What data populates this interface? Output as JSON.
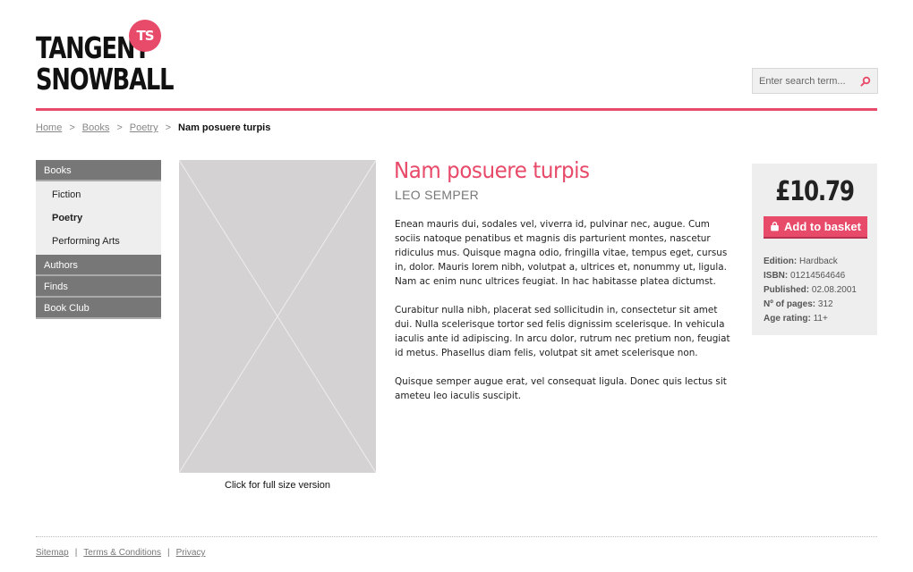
{
  "brand": {
    "line1": "TANGENT",
    "line2": "SNOWBALL",
    "badge": "TS",
    "accent_color": "#e84a69"
  },
  "search": {
    "placeholder": "Enter search term...",
    "icon": "search-icon"
  },
  "breadcrumb": {
    "items": [
      "Home",
      "Books",
      "Poetry"
    ],
    "separator": ">",
    "current": "Nam posuere turpis"
  },
  "sidebar": {
    "books": "Books",
    "sub_items": [
      "Fiction",
      "Poetry",
      "Performing Arts"
    ],
    "active_sub": "Poetry",
    "authors": "Authors",
    "finds": "Finds",
    "book_club": "Book Club"
  },
  "image": {
    "caption": "Click for full size version"
  },
  "book": {
    "title": "Nam posuere turpis",
    "author": "LEO SEMPER",
    "paragraphs": [
      "Enean mauris dui, sodales vel, viverra id, pulvinar nec, augue. Cum sociis natoque penatibus et magnis dis parturient montes, nascetur ridiculus mus. Quisque magna odio, fringilla vitae, tempus eget, cursus in, dolor. Mauris lorem nibh, volutpat a, ultrices et, nonummy ut, ligula. Nam ac enim nunc ultrices feugiat. In hac habitasse platea dictumst.",
      "Curabitur nulla nibh, placerat sed sollicitudin in, consectetur sit amet dui. Nulla scelerisque tortor sed felis dignissim scelerisque. In vehicula iaculis ante id adipiscing. In arcu dolor, rutrum nec pretium non, feugiat id metus. Phasellus diam felis, volutpat sit amet scelerisque non.",
      "Quisque semper augue erat, vel consequat ligula. Donec quis lectus sit ameteu leo iaculis suscipit."
    ]
  },
  "purchase": {
    "price": "£10.79",
    "basket_label": "Add to basket",
    "basket_icon": "shopping-bag-icon",
    "details": {
      "edition_label": "Edition:",
      "edition": "Hardback",
      "isbn_label": "ISBN:",
      "isbn": "01214564646",
      "published_label": "Published:",
      "published": "02.08.2001",
      "pages_label": "Nº of pages:",
      "pages": "312",
      "age_label": "Age rating:",
      "age": "11+"
    }
  },
  "footer": {
    "links": [
      "Sitemap",
      "Terms & Conditions",
      "Privacy"
    ],
    "separator": "|"
  }
}
